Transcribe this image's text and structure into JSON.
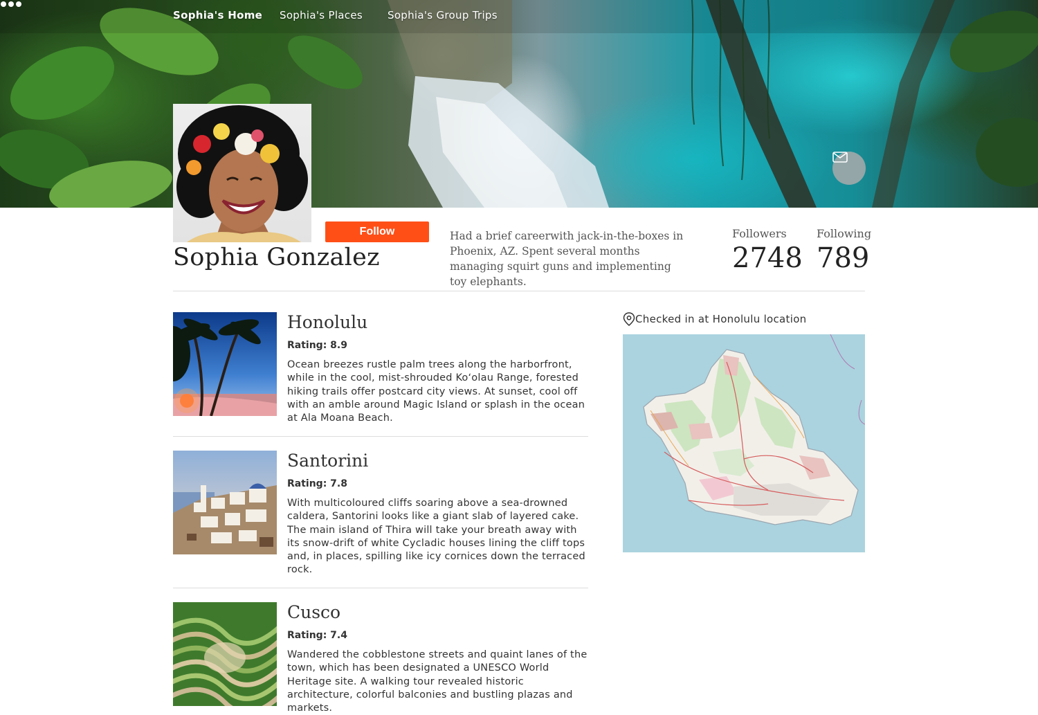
{
  "nav": {
    "items": [
      {
        "label": "Sophia's Home",
        "active": true
      },
      {
        "label": "Sophia's Places",
        "active": false
      },
      {
        "label": "Sophia's Group Trips",
        "active": false
      }
    ],
    "more_icon": "more-horizontal-icon"
  },
  "hero": {
    "mail_icon": "mail-icon"
  },
  "profile": {
    "name": "Sophia Gonzalez",
    "follow_label": "Follow",
    "bio": "Had a brief careerwith jack-in-the-boxes in Phoenix, AZ. Spent several months managing squirt guns and implementing toy elephants.",
    "followers_label": "Followers",
    "followers_count": "2748",
    "following_label": "Following",
    "following_count": "789"
  },
  "places": [
    {
      "title": "Honolulu",
      "rating": "Rating: 8.9",
      "description": "Ocean breezes rustle palm trees along the harborfront, while in the cool, mist-shrouded Koʻolau Range, forested hiking trails offer postcard city views. At sunset, cool off with an amble around Magic Island or splash in the ocean at Ala Moana Beach."
    },
    {
      "title": "Santorini",
      "rating": "Rating: 7.8",
      "description": "With multicoloured cliffs soaring above a sea-drowned caldera, Santorini looks like a giant slab of layered cake. The main island of Thira will take your breath away with its snow-drift of white Cycladic houses lining the cliff tops and, in places, spilling like icy cornices down the terraced rock."
    },
    {
      "title": "Cusco",
      "rating": "Rating: 7.4",
      "description": "Wandered the cobblestone streets and quaint lanes of the town, which has been designated a UNESCO World Heritage site. A walking tour revealed historic architecture, colorful balconies and bustling plazas and markets."
    }
  ],
  "checkin": {
    "icon": "map-pin-icon",
    "text": "Checked in at Honolulu location"
  },
  "colors": {
    "follow_button": "#ff4f17",
    "divider": "#dddddd",
    "map_water": "#aad3df",
    "map_land": "#f2efe9"
  }
}
